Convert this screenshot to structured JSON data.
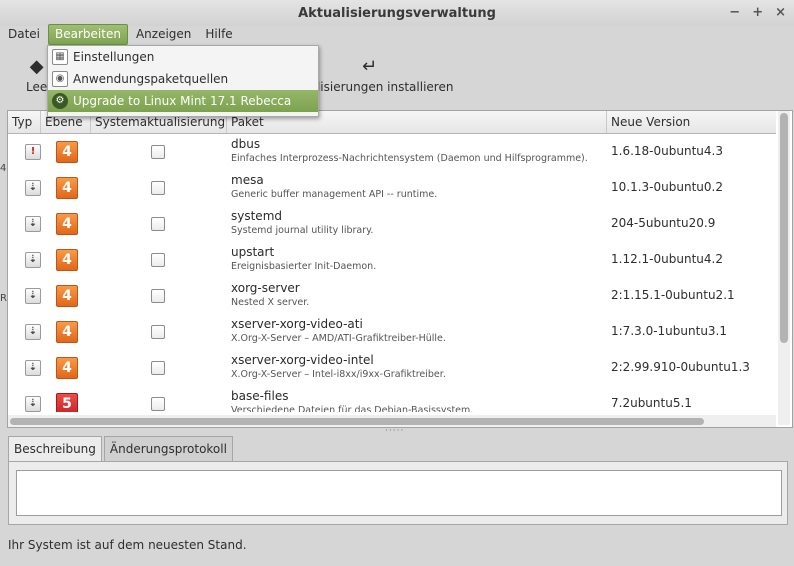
{
  "window": {
    "title": "Aktualisierungsverwaltung",
    "controls": [
      "−",
      "+",
      "×"
    ]
  },
  "menubar": {
    "items": [
      "Datei",
      "Bearbeiten",
      "Anzeigen",
      "Hilfe"
    ],
    "active": "Bearbeiten"
  },
  "dropdown": {
    "items": [
      {
        "label": "Einstellungen",
        "icon": "preferences-icon"
      },
      {
        "label": "Anwendungspaketquellen",
        "icon": "software-sources-icon"
      },
      {
        "label": "Upgrade to Linux Mint 17.1 Rebecca",
        "icon": "gear-icon",
        "highlighted": true
      }
    ]
  },
  "toolbar": {
    "left_label": "Lee",
    "install_label": "ualisierungen installieren"
  },
  "table": {
    "columns": [
      "Typ",
      "Ebene",
      "Systemaktualisierung",
      "Paket",
      "Neue Version"
    ],
    "rows": [
      {
        "type": "security",
        "level": "4",
        "name": "dbus",
        "desc": "Einfaches Interprozess-Nachrichtensystem (Daemon und Hilfsprogramme).",
        "version": "1.6.18-0ubuntu4.3"
      },
      {
        "type": "update",
        "level": "4",
        "name": "mesa",
        "desc": "Generic buffer management API -- runtime.",
        "version": "10.1.3-0ubuntu0.2"
      },
      {
        "type": "update",
        "level": "4",
        "name": "systemd",
        "desc": "Systemd journal utility library.",
        "version": "204-5ubuntu20.9"
      },
      {
        "type": "update",
        "level": "4",
        "name": "upstart",
        "desc": "Ereignisbasierter Init-Daemon.",
        "version": "1.12.1-0ubuntu4.2"
      },
      {
        "type": "update",
        "level": "4",
        "name": "xorg-server",
        "desc": "Nested X server.",
        "version": "2:1.15.1-0ubuntu2.1"
      },
      {
        "type": "update",
        "level": "4",
        "name": "xserver-xorg-video-ati",
        "desc": "X.Org-X-Server – AMD/ATI-Grafiktreiber-Hülle.",
        "version": "1:7.3.0-1ubuntu3.1"
      },
      {
        "type": "update",
        "level": "4",
        "name": "xserver-xorg-video-intel",
        "desc": "X.Org-X-Server – Intel-i8xx/i9xx-Grafiktreiber.",
        "version": "2:2.99.910-0ubuntu1.3"
      },
      {
        "type": "update",
        "level": "5",
        "name": "base-files",
        "desc": "Verschiedene Dateien für das Debian-Basissystem.",
        "version": "7.2ubuntu5.1"
      }
    ]
  },
  "tabs": {
    "items": [
      "Beschreibung",
      "Änderungsprotokoll"
    ],
    "active": "Beschreibung"
  },
  "status": {
    "text": "Ihr System ist auf dem neuesten Stand."
  }
}
